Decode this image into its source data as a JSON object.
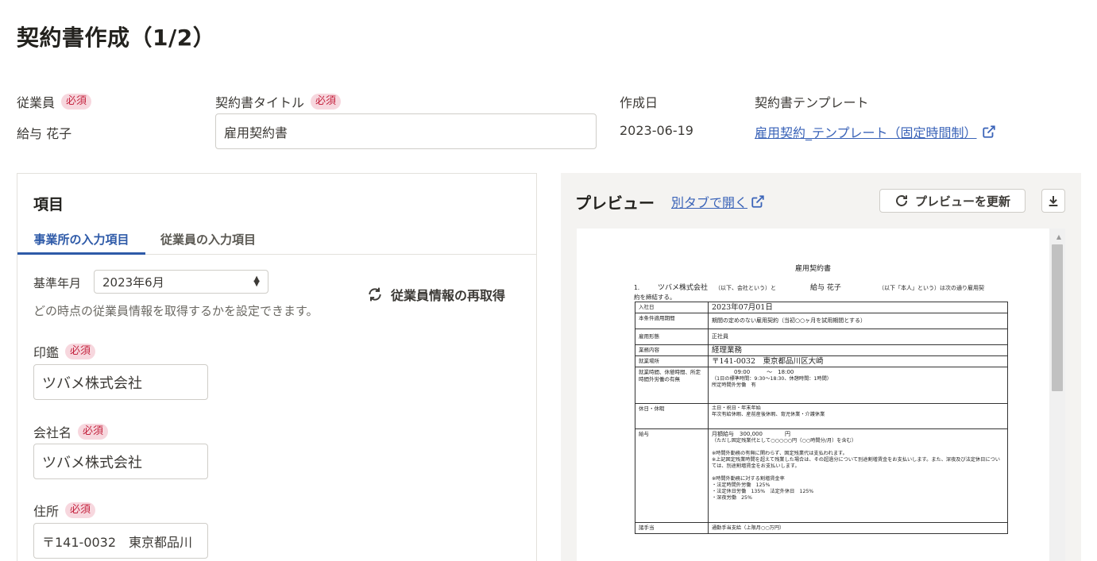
{
  "page_title": "契約書作成（1/2）",
  "required_badge": "必須",
  "employee": {
    "label": "従業員",
    "value": "給与 花子"
  },
  "contract_title": {
    "label": "契約書タイトル",
    "value": "雇用契約書"
  },
  "created_date": {
    "label": "作成日",
    "value": "2023-06-19"
  },
  "template": {
    "label": "契約書テンプレート",
    "link_text": "雇用契約_テンプレート（固定時間制）"
  },
  "items_panel": {
    "heading": "項目",
    "tabs": [
      {
        "label": "事業所の入力項目",
        "active": true
      },
      {
        "label": "従業員の入力項目",
        "active": false
      }
    ],
    "base_month": {
      "label": "基準年月",
      "value": "2023年6月"
    },
    "refetch_button": "従業員情報の再取得",
    "hint": "どの時点の従業員情報を取得するかを設定できます。",
    "fields": [
      {
        "label": "印鑑",
        "value": "ツバメ株式会社"
      },
      {
        "label": "会社名",
        "value": "ツバメ株式会社"
      },
      {
        "label": "住所",
        "value": "〒141-0032　東京都品川"
      }
    ]
  },
  "preview": {
    "title": "プレビュー",
    "open_tab_link": "別タブで開く",
    "refresh_button": "プレビューを更新",
    "document": {
      "title": "雇用契約書",
      "intro_num": "1.",
      "intro_company": "ツバメ株式会社",
      "intro_company_note": "（以下、会社という）と",
      "intro_employee": "給与 花子",
      "intro_employee_note": "（以下「本人」という）は次の通り雇用契",
      "intro_line2": "約を締結する。",
      "rows": [
        {
          "key": "入社日",
          "value": "2023年07月01日"
        },
        {
          "key": "本条件適用期間",
          "value": "期間の定めのない雇用契約（当初○○ヶ月を試用期間とする）"
        },
        {
          "key": "雇用形態",
          "value": "正社員"
        },
        {
          "key": "業務内容",
          "value": "経理業務"
        },
        {
          "key": "就業場所",
          "value": "〒141-0032　東京都品川区大崎"
        },
        {
          "key": "就業時間、休憩時間、所定時間外労働の有無",
          "value": "09:00　　　～　18:00",
          "line2": "（1日の標準時間：9:30～18:30、休憩時間：1時間）",
          "line3": "所定時間外労働　有"
        },
        {
          "key": "休日・休暇",
          "value": "土日・祝日・年末年始",
          "line2": "年次有給休暇、産前産後休暇、育児休業・介護休業"
        },
        {
          "key": "給与",
          "value": "月額給与　300,000　　　　円",
          "line2": "（ただし固定残業代として○○○○○円（○○時間分/月）を含む）",
          "line3": "※時間外勤務の有無に関わらず、固定残業代は支払われます。",
          "line4": "※上記固定残業時間を超えて残業した場合は、その超過分について別途割増賃金をお支払いします。また、深夜及び法定休日については、別途割増賃金をお支払いします。",
          "line5": "※時間外勤務に対する割増賃金率",
          "line6": "・法定時間外労働　125%",
          "line7": "・法定休日労働　135%　法定外休日　125%",
          "line8": "・深夜労働　25%"
        },
        {
          "key": "諸手当",
          "value": "通勤手当支給（上限月○○万円）"
        }
      ]
    }
  },
  "colors": {
    "accent": "#2e5aa8",
    "link": "#3a63b8",
    "required_bg": "#f7d7de",
    "required_text": "#c4243f"
  }
}
